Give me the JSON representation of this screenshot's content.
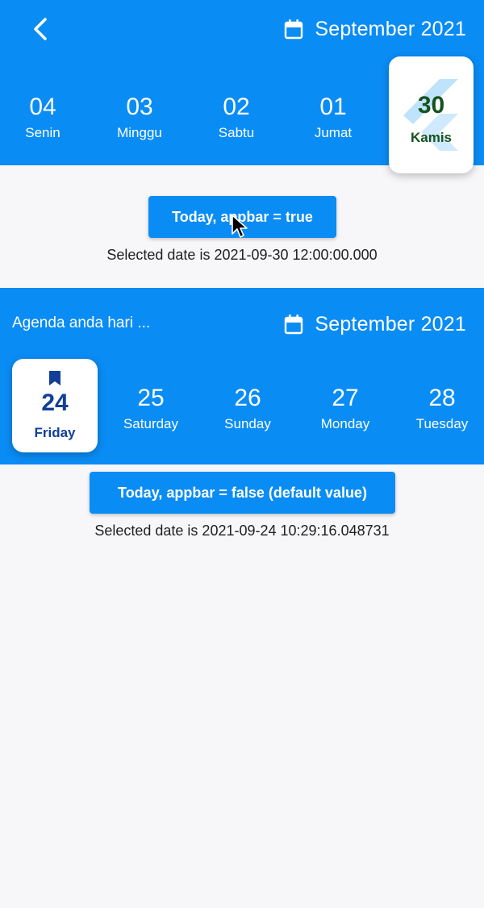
{
  "top_bar": {
    "back_icon": "chevron-left-icon",
    "calendar_icon": "calendar-icon",
    "month": "September 2021",
    "days": [
      {
        "num": "04",
        "name": "Senin"
      },
      {
        "num": "03",
        "name": "Minggu"
      },
      {
        "num": "02",
        "name": "Sabtu"
      },
      {
        "num": "01",
        "name": "Jumat"
      }
    ],
    "selected": {
      "num": "30",
      "name": "Kamis"
    }
  },
  "section1": {
    "button_label": "Today, appbar = true",
    "selected_text": "Selected date is 2021-09-30 12:00:00.000"
  },
  "second_bar": {
    "title": "Agenda anda hari ...",
    "calendar_icon": "calendar-icon",
    "month": "September 2021",
    "selected": {
      "num": "24",
      "name": "Friday",
      "icon": "bookmark-icon"
    },
    "days": [
      {
        "num": "25",
        "name": "Saturday"
      },
      {
        "num": "26",
        "name": "Sunday"
      },
      {
        "num": "27",
        "name": "Monday"
      },
      {
        "num": "28",
        "name": "Tuesday"
      }
    ]
  },
  "section2": {
    "button_label": "Today, appbar = false (default value)",
    "selected_text": "Selected date is 2021-09-24 10:29:16.048731"
  },
  "colors": {
    "primary": "#0a8cf5",
    "background": "#f7f6f9",
    "selected_top_text": "#14531f",
    "selected_bottom_text": "#123f98"
  }
}
